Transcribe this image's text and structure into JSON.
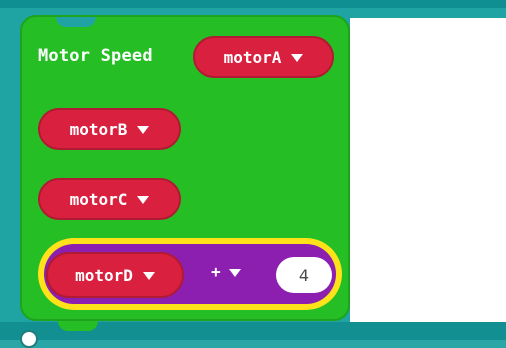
{
  "block": {
    "label": "Motor Speed",
    "dropdowns": {
      "motorA": "motorA",
      "motorB": "motorB",
      "motorC": "motorC",
      "motorD": "motorD"
    },
    "operator": "+",
    "number_value": "4"
  },
  "colors": {
    "workspace": "#1fa3a3",
    "block_green": "#25bf25",
    "pill_red": "#d9213f",
    "purple": "#8d1fb0",
    "highlight_yellow": "#ffe21a"
  },
  "icons": {
    "dropdown": "chevron-down-icon",
    "bottom": "circle-icon"
  }
}
